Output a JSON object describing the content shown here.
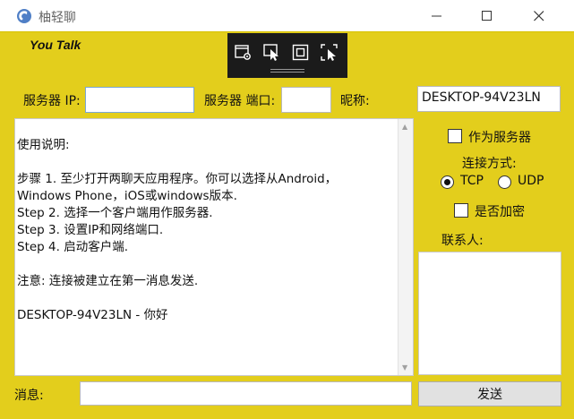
{
  "window": {
    "title": "柚轻聊"
  },
  "brand": {
    "text": "You Talk"
  },
  "toolbar": {
    "icons": [
      "settings-window-icon",
      "select-arrow-icon",
      "frame-icon",
      "select-region-icon"
    ]
  },
  "connection": {
    "server_ip_label": "服务器 IP:",
    "server_ip_value": "",
    "server_port_label": "服务器 端口:",
    "server_port_value": "",
    "nickname_label": "昵称:",
    "nickname_value": "DESKTOP-94V23LN"
  },
  "instructions": {
    "heading": "使用说明:",
    "step1": "步骤 1. 至少打开两聊天应用程序。你可以选择从Android，\nWindows Phone，iOS或windows版本.",
    "step2": "Step 2. 选择一个客户端用作服务器.",
    "step3": "Step 3. 设置IP和网络端口.",
    "step4": "Step 4. 启动客户端.",
    "note": "注意: 连接被建立在第一消息发送.",
    "message": "DESKTOP-94V23LN - 你好"
  },
  "options": {
    "as_server_label": "作为服务器",
    "as_server_checked": false,
    "connection_type_label": "连接方式:",
    "tcp_label": "TCP",
    "udp_label": "UDP",
    "selected_protocol": "TCP",
    "encrypt_label": "是否加密",
    "encrypt_checked": false
  },
  "contacts": {
    "label": "联系人:",
    "items": []
  },
  "compose": {
    "message_label": "消息:",
    "message_value": "",
    "send_label": "发送"
  }
}
